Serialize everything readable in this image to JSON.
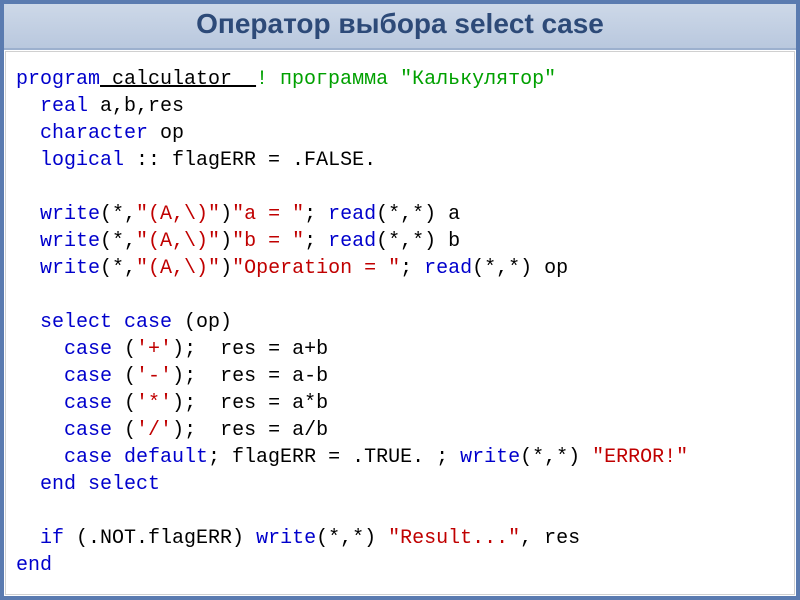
{
  "title": "Оператор выбора select case",
  "code": {
    "l1": {
      "kw": "program",
      "id": " calculator  ",
      "cm": "! программа \"Калькулятор\""
    },
    "l2": {
      "kw": "real",
      "rest": " a,b,res"
    },
    "l3": {
      "kw": "character",
      "rest": " op"
    },
    "l4": {
      "kw": "logical",
      "rest": " :: flagERR = .FALSE."
    },
    "l5": {
      "kw": "write",
      "a": "(*,",
      "s1": "\"(A,\\)\"",
      "b": ")",
      "s2": "\"a = \"",
      "c": "; ",
      "kw2": "read",
      "d": "(*,*) a"
    },
    "l6": {
      "kw": "write",
      "a": "(*,",
      "s1": "\"(A,\\)\"",
      "b": ")",
      "s2": "\"b = \"",
      "c": "; ",
      "kw2": "read",
      "d": "(*,*) b"
    },
    "l7": {
      "kw": "write",
      "a": "(*,",
      "s1": "\"(A,\\)\"",
      "b": ")",
      "s2": "\"Operation = \"",
      "c": "; ",
      "kw2": "read",
      "d": "(*,*) op"
    },
    "l8": {
      "kw": "select case",
      "rest": " (op)"
    },
    "l9": {
      "kw": "case",
      "a": " (",
      "s": "'+'",
      "b": ");  res = a+b"
    },
    "l10": {
      "kw": "case",
      "a": " (",
      "s": "'-'",
      "b": ");  res = a-b"
    },
    "l11": {
      "kw": "case",
      "a": " (",
      "s": "'*'",
      "b": ");  res = a*b"
    },
    "l12": {
      "kw": "case",
      "a": " (",
      "s": "'/'",
      "b": ");  res = a/b"
    },
    "l13": {
      "kw": "case default",
      "a": "; flagERR = .TRUE. ; ",
      "kw2": "write",
      "b": "(*,*) ",
      "s": "\"ERROR!\""
    },
    "l14": {
      "kw": "end select"
    },
    "l15": {
      "kw": "if",
      "a": " (.NOT.flagERR) ",
      "kw2": "write",
      "b": "(*,*) ",
      "s": "\"Result...\"",
      "c": ", res"
    },
    "l16": {
      "kw": "end"
    }
  }
}
